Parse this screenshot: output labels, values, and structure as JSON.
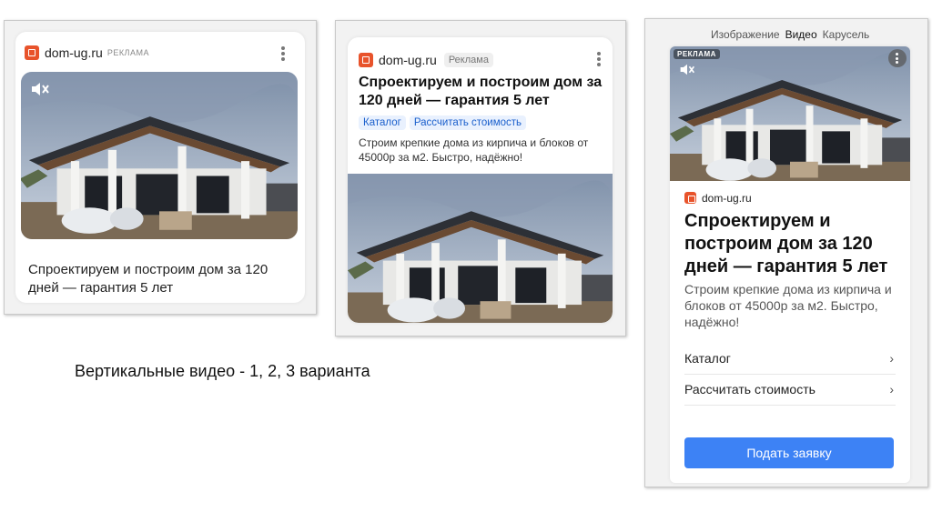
{
  "caption": "Вертикальные видео - 1, 2, 3 варианта",
  "brand_color": "#e8532b",
  "button_color": "#3d82f5",
  "variant1": {
    "domain": "dom-ug.ru",
    "ad_label": "РЕКЛАМА",
    "headline": "Спроектируем и построим дом за 120 дней — гарантия 5 лет",
    "muted": true
  },
  "variant2": {
    "domain": "dom-ug.ru",
    "ad_label": "Реклама",
    "headline": "Спроектируем и построим дом за 120 дней — гарантия 5 лет",
    "chips": [
      "Каталог",
      "Рассчитать стоимость"
    ],
    "description": "Строим крепкие дома из кирпича и блоков от 45000р за м2. Быстро, надёжно!"
  },
  "variant3": {
    "tabs": [
      "Изображение",
      "Видео",
      "Карусель"
    ],
    "active_tab": "Видео",
    "ad_label": "РЕКЛАМА",
    "domain": "dom-ug.ru",
    "headline": "Спроектируем и построим дом за 120 дней — гарантия 5 лет",
    "description": "Строим крепкие дома из кирпича и блоков от 45000р за м2. Быстро, надёжно!",
    "links": [
      "Каталог",
      "Рассчитать стоимость"
    ],
    "cta": "Подать заявку"
  }
}
